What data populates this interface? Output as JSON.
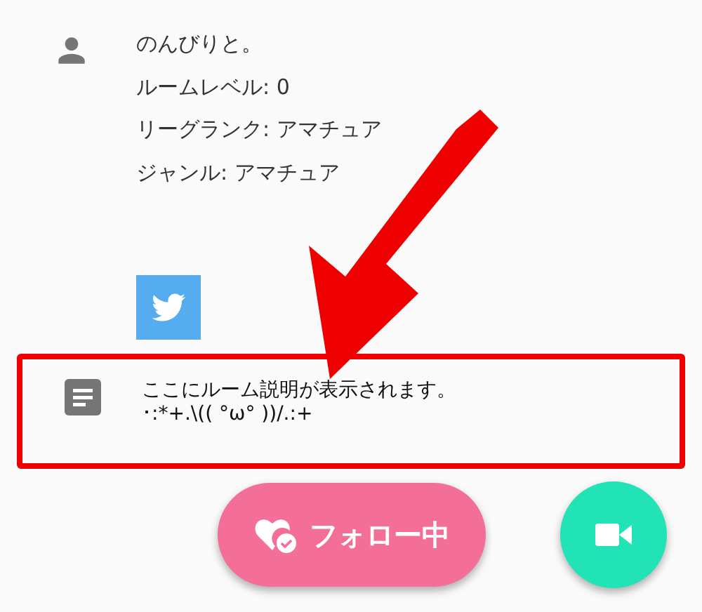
{
  "room_info": {
    "lines": [
      "のんびりと。",
      "ルームレベル: 0",
      "リーグランク: アマチュア",
      "ジャンル: アマチュア"
    ]
  },
  "description": {
    "lines": [
      "ここにルーム説明が表示されます。",
      "･:*+.\\(( °ω° ))/.:+"
    ],
    "highlighted": true
  },
  "follow_button": {
    "label": "フォロー中",
    "following": true
  }
}
